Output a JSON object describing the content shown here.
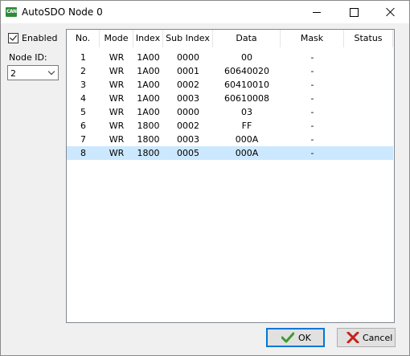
{
  "window": {
    "title": "AutoSDO Node 0",
    "icon_text": "CAN"
  },
  "left_panel": {
    "enabled_label": "Enabled",
    "enabled_checked": true,
    "node_id_label": "Node ID:",
    "node_id_value": "2"
  },
  "table": {
    "columns": [
      "No.",
      "Mode",
      "Index",
      "Sub Index",
      "Data",
      "Mask",
      "Status"
    ],
    "rows": [
      [
        "1",
        "WR",
        "1A00",
        "0000",
        "00",
        "-",
        ""
      ],
      [
        "2",
        "WR",
        "1A00",
        "0001",
        "60640020",
        "-",
        ""
      ],
      [
        "3",
        "WR",
        "1A00",
        "0002",
        "60410010",
        "-",
        ""
      ],
      [
        "4",
        "WR",
        "1A00",
        "0003",
        "60610008",
        "-",
        ""
      ],
      [
        "5",
        "WR",
        "1A00",
        "0000",
        "03",
        "-",
        ""
      ],
      [
        "6",
        "WR",
        "1800",
        "0002",
        "FF",
        "-",
        ""
      ],
      [
        "7",
        "WR",
        "1800",
        "0003",
        "000A",
        "-",
        ""
      ],
      [
        "8",
        "WR",
        "1800",
        "0005",
        "000A",
        "-",
        ""
      ]
    ],
    "selected_row": 8
  },
  "buttons": {
    "ok_label": "OK",
    "cancel_label": "Cancel"
  },
  "colors": {
    "selection": "#cce8ff",
    "ok_icon": "#3c9c2e",
    "cancel_icon": "#c4231c"
  },
  "icons": {
    "app": "can-app-icon",
    "ok": "checkmark-icon",
    "cancel": "x-icon"
  }
}
